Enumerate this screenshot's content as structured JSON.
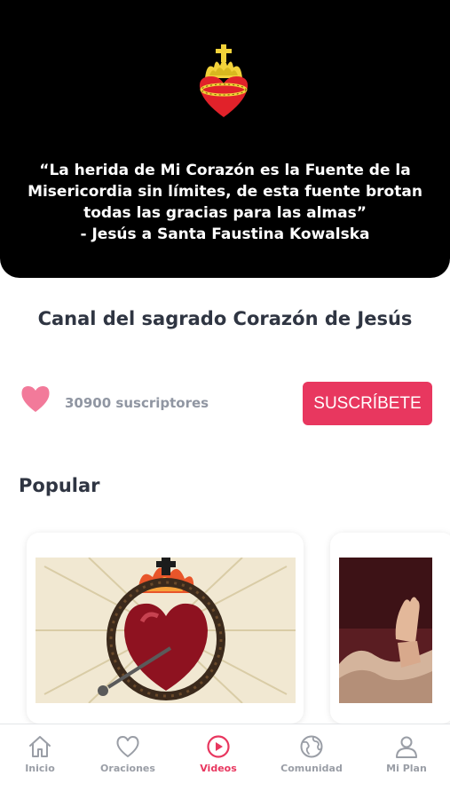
{
  "header": {
    "logo_icon": "sacred-heart-icon",
    "quote_lines": [
      "“La herida de Mi Corazón es la Fuente de la",
      "Misericordia sin límites, de esta fuente brotan",
      "todas las gracias para las almas”",
      "- Jesús a Santa Faustina Kowalska"
    ]
  },
  "channel": {
    "title": "Canal del sagrado Corazón de Jesús",
    "subscribers_label": "30900 suscriptores",
    "subscribe_button": "SUSCRÍBETE"
  },
  "popular": {
    "title": "Popular",
    "videos": [
      {
        "thumbnail": "sacred-heart-with-crown-of-thorns-image"
      },
      {
        "thumbnail": "raised-hand-painting-image"
      }
    ]
  },
  "tabbar": {
    "items": [
      {
        "label": "Inicio",
        "icon": "home-icon",
        "active": false
      },
      {
        "label": "Oraciones",
        "icon": "heart-outline-icon",
        "active": false
      },
      {
        "label": "Videos",
        "icon": "play-circle-icon",
        "active": true
      },
      {
        "label": "Comunidad",
        "icon": "globe-icon",
        "active": false
      },
      {
        "label": "Mi Plan",
        "icon": "person-icon",
        "active": false
      }
    ]
  },
  "colors": {
    "accent": "#e8375f",
    "header_bg": "#000000",
    "heart_pink": "#f27a9a",
    "text_dark": "#2f3542",
    "text_muted": "#9096a2"
  }
}
